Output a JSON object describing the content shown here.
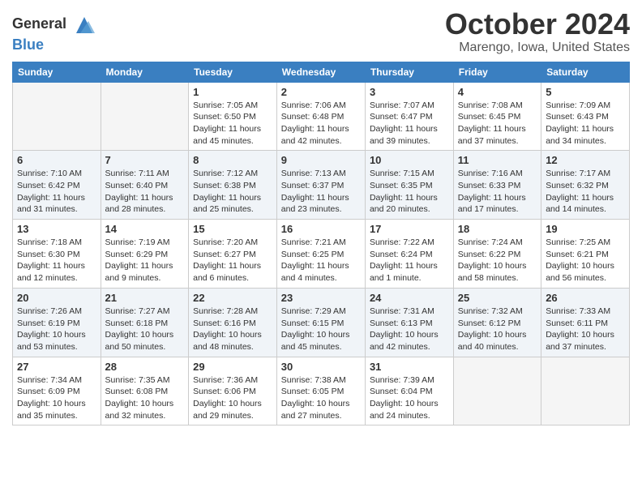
{
  "logo": {
    "general": "General",
    "blue": "Blue"
  },
  "title": "October 2024",
  "location": "Marengo, Iowa, United States",
  "days_of_week": [
    "Sunday",
    "Monday",
    "Tuesday",
    "Wednesday",
    "Thursday",
    "Friday",
    "Saturday"
  ],
  "weeks": [
    [
      {
        "day": "",
        "sunrise": "",
        "sunset": "",
        "daylight": ""
      },
      {
        "day": "",
        "sunrise": "",
        "sunset": "",
        "daylight": ""
      },
      {
        "day": "1",
        "sunrise": "Sunrise: 7:05 AM",
        "sunset": "Sunset: 6:50 PM",
        "daylight": "Daylight: 11 hours and 45 minutes."
      },
      {
        "day": "2",
        "sunrise": "Sunrise: 7:06 AM",
        "sunset": "Sunset: 6:48 PM",
        "daylight": "Daylight: 11 hours and 42 minutes."
      },
      {
        "day": "3",
        "sunrise": "Sunrise: 7:07 AM",
        "sunset": "Sunset: 6:47 PM",
        "daylight": "Daylight: 11 hours and 39 minutes."
      },
      {
        "day": "4",
        "sunrise": "Sunrise: 7:08 AM",
        "sunset": "Sunset: 6:45 PM",
        "daylight": "Daylight: 11 hours and 37 minutes."
      },
      {
        "day": "5",
        "sunrise": "Sunrise: 7:09 AM",
        "sunset": "Sunset: 6:43 PM",
        "daylight": "Daylight: 11 hours and 34 minutes."
      }
    ],
    [
      {
        "day": "6",
        "sunrise": "Sunrise: 7:10 AM",
        "sunset": "Sunset: 6:42 PM",
        "daylight": "Daylight: 11 hours and 31 minutes."
      },
      {
        "day": "7",
        "sunrise": "Sunrise: 7:11 AM",
        "sunset": "Sunset: 6:40 PM",
        "daylight": "Daylight: 11 hours and 28 minutes."
      },
      {
        "day": "8",
        "sunrise": "Sunrise: 7:12 AM",
        "sunset": "Sunset: 6:38 PM",
        "daylight": "Daylight: 11 hours and 25 minutes."
      },
      {
        "day": "9",
        "sunrise": "Sunrise: 7:13 AM",
        "sunset": "Sunset: 6:37 PM",
        "daylight": "Daylight: 11 hours and 23 minutes."
      },
      {
        "day": "10",
        "sunrise": "Sunrise: 7:15 AM",
        "sunset": "Sunset: 6:35 PM",
        "daylight": "Daylight: 11 hours and 20 minutes."
      },
      {
        "day": "11",
        "sunrise": "Sunrise: 7:16 AM",
        "sunset": "Sunset: 6:33 PM",
        "daylight": "Daylight: 11 hours and 17 minutes."
      },
      {
        "day": "12",
        "sunrise": "Sunrise: 7:17 AM",
        "sunset": "Sunset: 6:32 PM",
        "daylight": "Daylight: 11 hours and 14 minutes."
      }
    ],
    [
      {
        "day": "13",
        "sunrise": "Sunrise: 7:18 AM",
        "sunset": "Sunset: 6:30 PM",
        "daylight": "Daylight: 11 hours and 12 minutes."
      },
      {
        "day": "14",
        "sunrise": "Sunrise: 7:19 AM",
        "sunset": "Sunset: 6:29 PM",
        "daylight": "Daylight: 11 hours and 9 minutes."
      },
      {
        "day": "15",
        "sunrise": "Sunrise: 7:20 AM",
        "sunset": "Sunset: 6:27 PM",
        "daylight": "Daylight: 11 hours and 6 minutes."
      },
      {
        "day": "16",
        "sunrise": "Sunrise: 7:21 AM",
        "sunset": "Sunset: 6:25 PM",
        "daylight": "Daylight: 11 hours and 4 minutes."
      },
      {
        "day": "17",
        "sunrise": "Sunrise: 7:22 AM",
        "sunset": "Sunset: 6:24 PM",
        "daylight": "Daylight: 11 hours and 1 minute."
      },
      {
        "day": "18",
        "sunrise": "Sunrise: 7:24 AM",
        "sunset": "Sunset: 6:22 PM",
        "daylight": "Daylight: 10 hours and 58 minutes."
      },
      {
        "day": "19",
        "sunrise": "Sunrise: 7:25 AM",
        "sunset": "Sunset: 6:21 PM",
        "daylight": "Daylight: 10 hours and 56 minutes."
      }
    ],
    [
      {
        "day": "20",
        "sunrise": "Sunrise: 7:26 AM",
        "sunset": "Sunset: 6:19 PM",
        "daylight": "Daylight: 10 hours and 53 minutes."
      },
      {
        "day": "21",
        "sunrise": "Sunrise: 7:27 AM",
        "sunset": "Sunset: 6:18 PM",
        "daylight": "Daylight: 10 hours and 50 minutes."
      },
      {
        "day": "22",
        "sunrise": "Sunrise: 7:28 AM",
        "sunset": "Sunset: 6:16 PM",
        "daylight": "Daylight: 10 hours and 48 minutes."
      },
      {
        "day": "23",
        "sunrise": "Sunrise: 7:29 AM",
        "sunset": "Sunset: 6:15 PM",
        "daylight": "Daylight: 10 hours and 45 minutes."
      },
      {
        "day": "24",
        "sunrise": "Sunrise: 7:31 AM",
        "sunset": "Sunset: 6:13 PM",
        "daylight": "Daylight: 10 hours and 42 minutes."
      },
      {
        "day": "25",
        "sunrise": "Sunrise: 7:32 AM",
        "sunset": "Sunset: 6:12 PM",
        "daylight": "Daylight: 10 hours and 40 minutes."
      },
      {
        "day": "26",
        "sunrise": "Sunrise: 7:33 AM",
        "sunset": "Sunset: 6:11 PM",
        "daylight": "Daylight: 10 hours and 37 minutes."
      }
    ],
    [
      {
        "day": "27",
        "sunrise": "Sunrise: 7:34 AM",
        "sunset": "Sunset: 6:09 PM",
        "daylight": "Daylight: 10 hours and 35 minutes."
      },
      {
        "day": "28",
        "sunrise": "Sunrise: 7:35 AM",
        "sunset": "Sunset: 6:08 PM",
        "daylight": "Daylight: 10 hours and 32 minutes."
      },
      {
        "day": "29",
        "sunrise": "Sunrise: 7:36 AM",
        "sunset": "Sunset: 6:06 PM",
        "daylight": "Daylight: 10 hours and 29 minutes."
      },
      {
        "day": "30",
        "sunrise": "Sunrise: 7:38 AM",
        "sunset": "Sunset: 6:05 PM",
        "daylight": "Daylight: 10 hours and 27 minutes."
      },
      {
        "day": "31",
        "sunrise": "Sunrise: 7:39 AM",
        "sunset": "Sunset: 6:04 PM",
        "daylight": "Daylight: 10 hours and 24 minutes."
      },
      {
        "day": "",
        "sunrise": "",
        "sunset": "",
        "daylight": ""
      },
      {
        "day": "",
        "sunrise": "",
        "sunset": "",
        "daylight": ""
      }
    ]
  ]
}
